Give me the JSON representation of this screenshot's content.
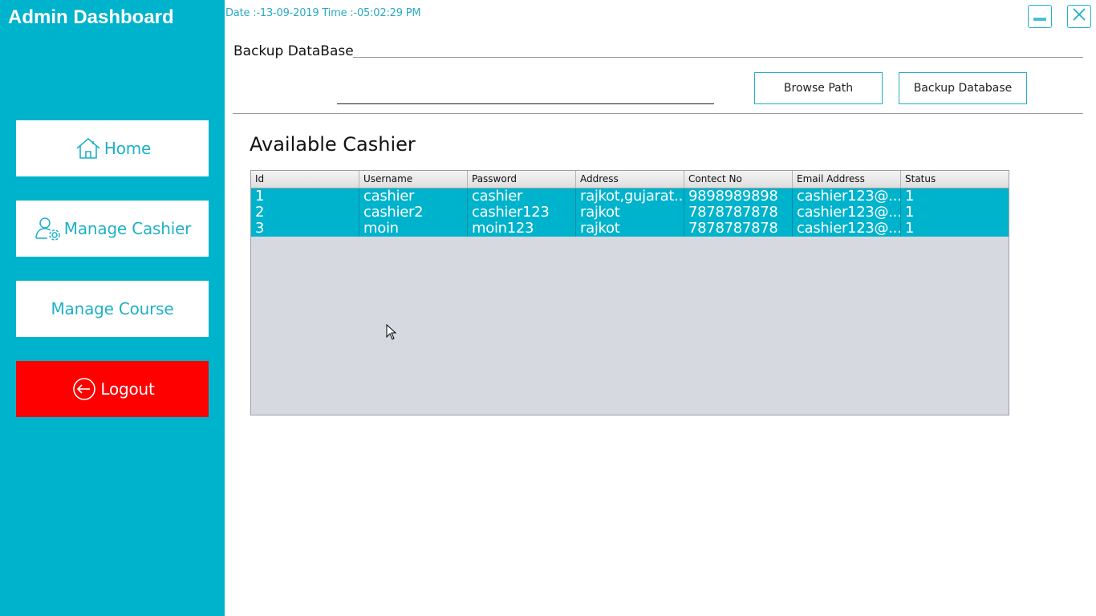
{
  "app": {
    "title": "Admin Dashboard"
  },
  "sidebar": {
    "items": [
      {
        "label": "Home",
        "icon": "home-icon"
      },
      {
        "label": "Manage Cashier",
        "icon": "user-gear-icon"
      },
      {
        "label": "Manage Course"
      },
      {
        "label": "Logout",
        "icon": "logout-icon"
      }
    ]
  },
  "header": {
    "datetime": "Date :-13-09-2019 Time :-05:02:29 PM",
    "minimize_icon": "minimize-icon",
    "close_icon": "close-icon"
  },
  "backup": {
    "title": "Backup DataBase",
    "path_value": "",
    "browse_label": "Browse Path",
    "backup_label": "Backup Database"
  },
  "cashiers": {
    "title": "Available Cashier",
    "columns": [
      "Id",
      "Username",
      "Password",
      "Address",
      "Contect No",
      "Email Address",
      "Status"
    ],
    "rows": [
      [
        "1",
        "cashier",
        "cashier",
        "rajkot,gujarat...",
        "9898989898",
        "cashier123@...",
        "1"
      ],
      [
        "2",
        "cashier2",
        "cashier123",
        "rajkot",
        "7878787878",
        "cashier123@...",
        "1"
      ],
      [
        "3",
        "moin",
        "moin123",
        "rajkot",
        "7878787878",
        "cashier123@...",
        "1"
      ]
    ]
  },
  "colors": {
    "sidebar": "#00b3cc",
    "accent": "#1fb0c8",
    "logout": "#ff0000",
    "table_empty": "#d6d9e0"
  }
}
